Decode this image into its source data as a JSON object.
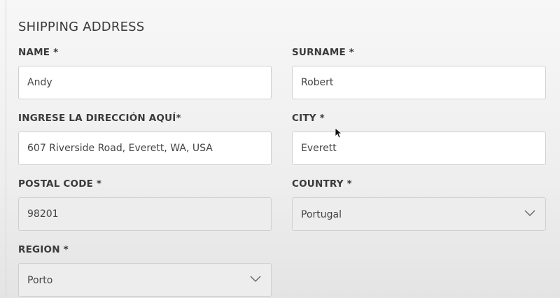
{
  "form": {
    "title": "SHIPPING ADDRESS",
    "name": {
      "label": "NAME *",
      "value": "Andy"
    },
    "surname": {
      "label": "SURNAME *",
      "value": "Robert"
    },
    "address": {
      "label": "INGRESE LA DIRECCIÓN AQUÍ*",
      "value": "607 Riverside Road, Everett, WA, USA"
    },
    "city": {
      "label": "CITY *",
      "value": "Everett"
    },
    "postal_code": {
      "label": "POSTAL CODE *",
      "value": "98201"
    },
    "country": {
      "label": "COUNTRY *",
      "value": "Portugal"
    },
    "region": {
      "label": "REGION *",
      "value": "Porto"
    }
  },
  "icons": {
    "dropdown": "chevron-down-icon",
    "pointer": "mouse-cursor-icon"
  }
}
